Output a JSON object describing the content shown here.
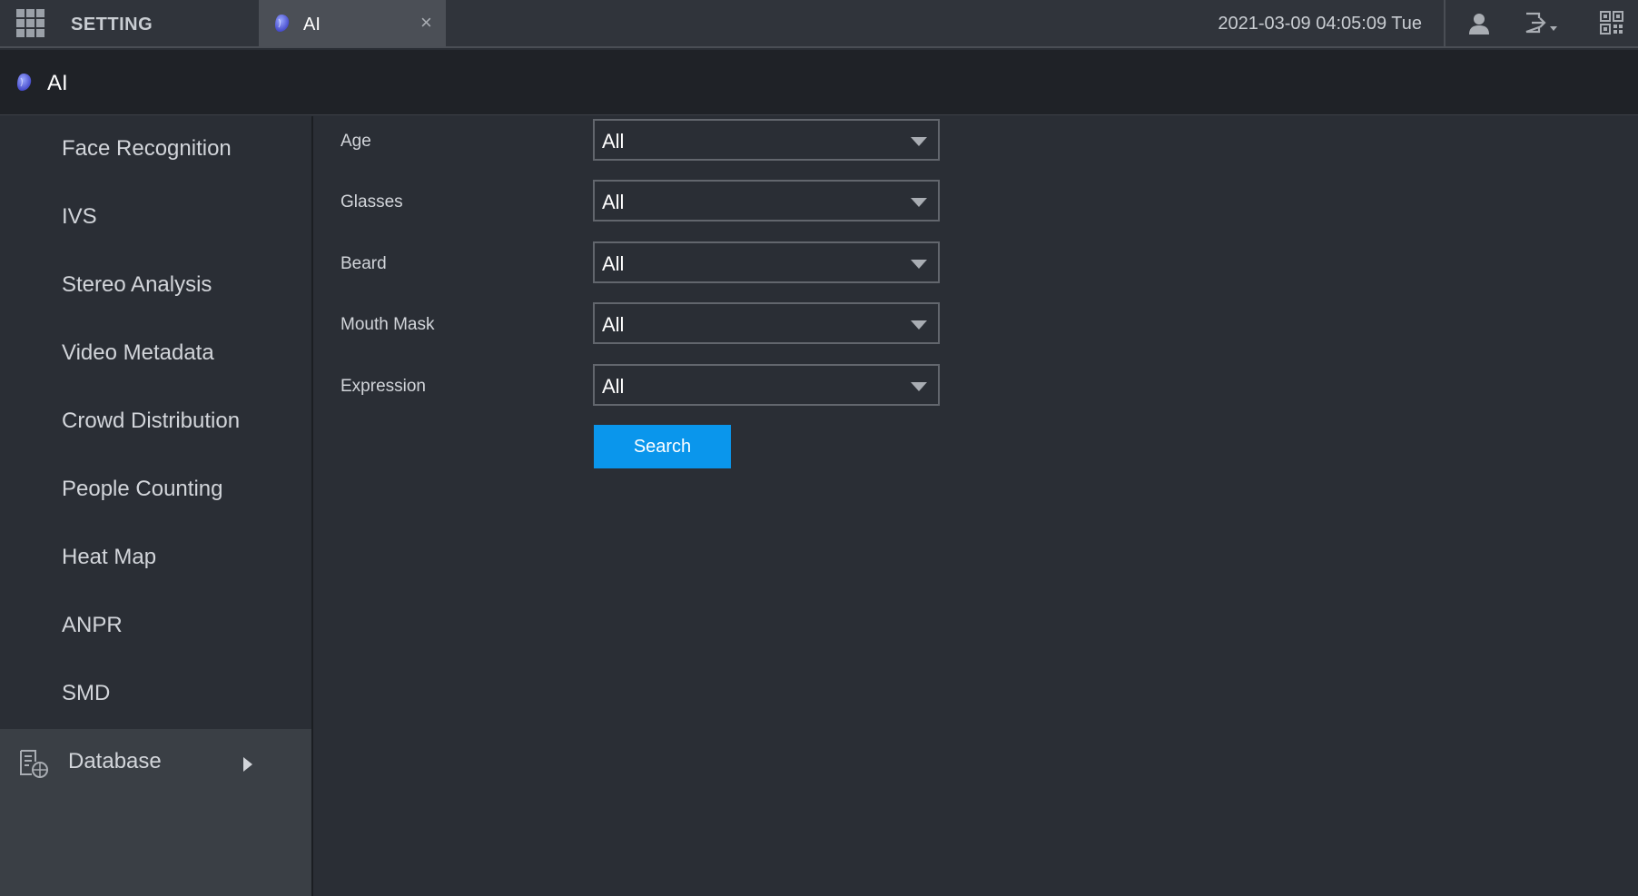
{
  "topbar": {
    "setting_label": "SETTING",
    "tab": {
      "label": "AI",
      "close_symbol": "×",
      "icon": "ai-globe-icon"
    },
    "datetime": "2021-03-09 04:05:09 Tue",
    "icons": [
      "user-icon",
      "logout-icon",
      "qr-code-icon"
    ]
  },
  "header": {
    "title": "AI",
    "icon": "ai-globe-icon"
  },
  "sidebar": {
    "items": [
      {
        "label": "Face Recognition"
      },
      {
        "label": "IVS"
      },
      {
        "label": "Stereo Analysis"
      },
      {
        "label": "Video Metadata"
      },
      {
        "label": "Crowd Distribution"
      },
      {
        "label": "People Counting"
      },
      {
        "label": "Heat Map"
      },
      {
        "label": "ANPR"
      },
      {
        "label": "SMD"
      }
    ],
    "database": {
      "label": "Database",
      "icon": "database-icon"
    }
  },
  "filters": [
    {
      "label": "Age",
      "value": "All"
    },
    {
      "label": "Glasses",
      "value": "All"
    },
    {
      "label": "Beard",
      "value": "All"
    },
    {
      "label": "Mouth Mask",
      "value": "All"
    },
    {
      "label": "Expression",
      "value": "All"
    }
  ],
  "search_label": "Search",
  "colors": {
    "accent": "#0a96ec",
    "topbar": "#30343b",
    "titlebar": "#1f2227",
    "background": "#2a2e35",
    "database_highlight": "#3a3f45"
  }
}
